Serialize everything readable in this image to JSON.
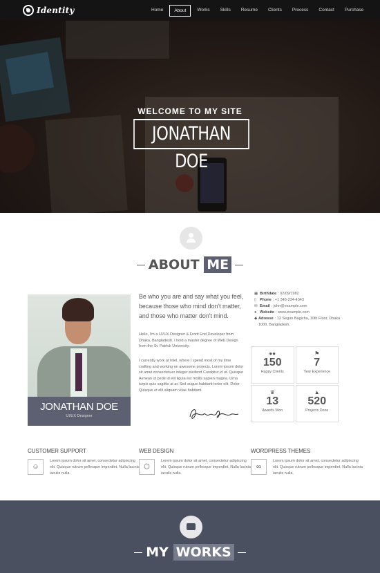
{
  "brand": {
    "logo_text": "Identity"
  },
  "nav": {
    "items": [
      {
        "label": "Home",
        "active": false
      },
      {
        "label": "About",
        "active": true
      },
      {
        "label": "Works",
        "active": false
      },
      {
        "label": "Skills",
        "active": false
      },
      {
        "label": "Resume",
        "active": false
      },
      {
        "label": "Clients",
        "active": false
      },
      {
        "label": "Process",
        "active": false
      },
      {
        "label": "Contact",
        "active": false
      },
      {
        "label": "Purchase",
        "active": false
      }
    ]
  },
  "hero": {
    "welcome": "WELCOME TO MY SITE",
    "name": "JONATHAN DOE"
  },
  "about": {
    "title_plain": "ABOUT",
    "title_highlight": "ME",
    "card_name": "JONATHAN DOE",
    "card_role": "UI/UX Designer",
    "intro": "Be who you are and say what you feel, because those who mind don't matter, and those who matter don't mind.",
    "bio_1": "Hello, I'm a UI/UX Designer & Front End Developer from Dhaka, Bangladesh. I hold a master degree of Web Design from the St. Patrick University.",
    "bio_2": "I currently work at Intel, where I spend most of my time crafting and working on awesome projects. Lorem ipsum dolor sit amet consectetuer integer eleifend Curabitur id ut. Quisque Aenean ut pede id elit ligula est mollis sapien magna. Urna turpis quis sagittis at ac Sed augue habitant tortor elit. Dolor Quisque et elit aliquam vitae habitant.",
    "info": {
      "birthdate_label": "Birthdate",
      "birthdate": ": 02/09/1982",
      "phone_label": "Phone",
      "phone": ": +1 343-234-4343",
      "email_label": "Email",
      "email": ": john@example.com",
      "website_label": "Website",
      "website": ": www.example.com",
      "address_label": "Adresse",
      "address": ": 12 Segun Bagicha, 10th Floor, Dhaka 1000, Bangladesh."
    },
    "stats": [
      {
        "icon": "users-icon",
        "value": "150",
        "label": "Happy Clients"
      },
      {
        "icon": "flag-icon",
        "value": "7",
        "label": "Year Experience"
      },
      {
        "icon": "trophy-icon",
        "value": "13",
        "label": "Awards Won"
      },
      {
        "icon": "thumbs-up-icon",
        "value": "520",
        "label": "Projects Done"
      }
    ]
  },
  "services": [
    {
      "title": "CUSTOMER SUPPORT",
      "icon": "smile-icon",
      "text": "Lorem ipsum dolor sit amet, consectetur adipiscing elit. Quisque rutrum pellesque imperdiet. Nulla lacinia iaculis nulla."
    },
    {
      "title": "WEB DESIGN",
      "icon": "html5-icon",
      "text": "Lorem ipsum dolor sit amet, consectetur adipiscing elit. Quisque rutrum pellesque imperdiet. Nulla lacinia iaculis nulla."
    },
    {
      "title": "WORDPRESS THEMES",
      "icon": "link-icon",
      "text": "Lorem ipsum dolor sit amet, consectetur adipiscing elit. Quisque rutrum pellesque imperdiet. Nulla lacinia iaculis nulla."
    }
  ],
  "works": {
    "title_plain": "MY",
    "title_highlight": "WORKS"
  },
  "colors": {
    "accent": "#5d6070",
    "works_bg": "#4b5061",
    "nav_bg": "#141414"
  }
}
